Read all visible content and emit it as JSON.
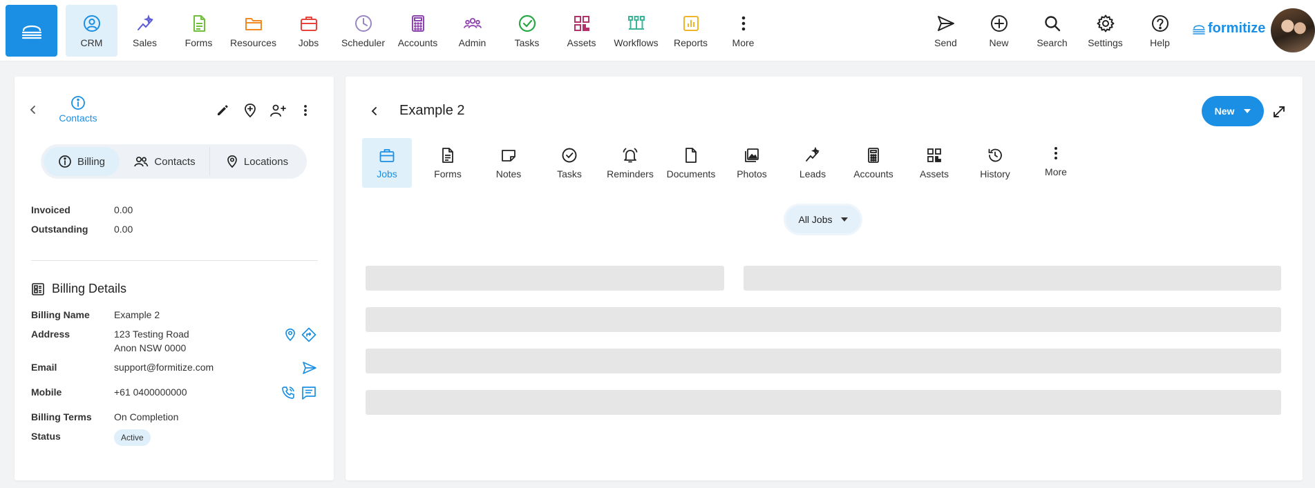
{
  "app": {
    "brand_name": "formitize",
    "accent_color": "#1a8fe3"
  },
  "topnav": {
    "items": [
      {
        "label": "CRM",
        "icon": "crm-icon",
        "color": "#1a8fe3",
        "active": true
      },
      {
        "label": "Sales",
        "icon": "sales-icon",
        "color": "#5b5bd6"
      },
      {
        "label": "Forms",
        "icon": "forms-icon",
        "color": "#6fbf3a"
      },
      {
        "label": "Resources",
        "icon": "folder-icon",
        "color": "#f08a24"
      },
      {
        "label": "Jobs",
        "icon": "briefcase-icon",
        "color": "#e8423c"
      },
      {
        "label": "Scheduler",
        "icon": "clock-icon",
        "color": "#9a86c4"
      },
      {
        "label": "Accounts",
        "icon": "calculator-icon",
        "color": "#8e44ad"
      },
      {
        "label": "Admin",
        "icon": "users-icon",
        "color": "#8e44ad"
      },
      {
        "label": "Tasks",
        "icon": "check-circle-icon",
        "color": "#27a745"
      },
      {
        "label": "Assets",
        "icon": "qr-icon",
        "color": "#b5316a"
      },
      {
        "label": "Workflows",
        "icon": "workflow-icon",
        "color": "#3ab59a"
      },
      {
        "label": "Reports",
        "icon": "chart-icon",
        "color": "#f0b429"
      },
      {
        "label": "More",
        "icon": "more-vertical-icon",
        "color": "#222222"
      }
    ],
    "right_items": [
      {
        "label": "Send",
        "icon": "send-icon"
      },
      {
        "label": "New",
        "icon": "plus-circle-icon"
      },
      {
        "label": "Search",
        "icon": "search-icon"
      },
      {
        "label": "Settings",
        "icon": "gear-icon"
      },
      {
        "label": "Help",
        "icon": "help-icon"
      }
    ]
  },
  "left_panel": {
    "contacts_label": "Contacts",
    "segments": [
      {
        "label": "Billing",
        "icon": "info-icon",
        "active": true
      },
      {
        "label": "Contacts",
        "icon": "users-icon"
      },
      {
        "label": "Locations",
        "icon": "pin-icon"
      }
    ],
    "summary": [
      {
        "label": "Invoiced",
        "value": "0.00"
      },
      {
        "label": "Outstanding",
        "value": "0.00"
      }
    ],
    "billing_details_title": "Billing Details",
    "details": {
      "billing_name_label": "Billing Name",
      "billing_name": "Example 2",
      "address_label": "Address",
      "address_line1": "123 Testing Road",
      "address_line2": "Anon NSW 0000",
      "email_label": "Email",
      "email": "support@formitize.com",
      "mobile_label": "Mobile",
      "mobile": "+61 0400000000",
      "billing_terms_label": "Billing Terms",
      "billing_terms": "On Completion",
      "status_label": "Status",
      "status": "Active"
    }
  },
  "right_panel": {
    "title": "Example 2",
    "new_button_label": "New",
    "tabs": [
      {
        "label": "Jobs",
        "icon": "briefcase-icon",
        "active": true
      },
      {
        "label": "Forms",
        "icon": "document-lines-icon"
      },
      {
        "label": "Notes",
        "icon": "note-icon"
      },
      {
        "label": "Tasks",
        "icon": "check-circle-icon"
      },
      {
        "label": "Reminders",
        "icon": "bell-icon"
      },
      {
        "label": "Documents",
        "icon": "file-icon"
      },
      {
        "label": "Photos",
        "icon": "photos-icon"
      },
      {
        "label": "Leads",
        "icon": "sparkle-icon"
      },
      {
        "label": "Accounts",
        "icon": "calculator-icon"
      },
      {
        "label": "Assets",
        "icon": "qr-icon"
      },
      {
        "label": "History",
        "icon": "history-icon"
      },
      {
        "label": "More",
        "icon": "more-vertical-icon"
      }
    ],
    "filter_label": "All Jobs"
  }
}
